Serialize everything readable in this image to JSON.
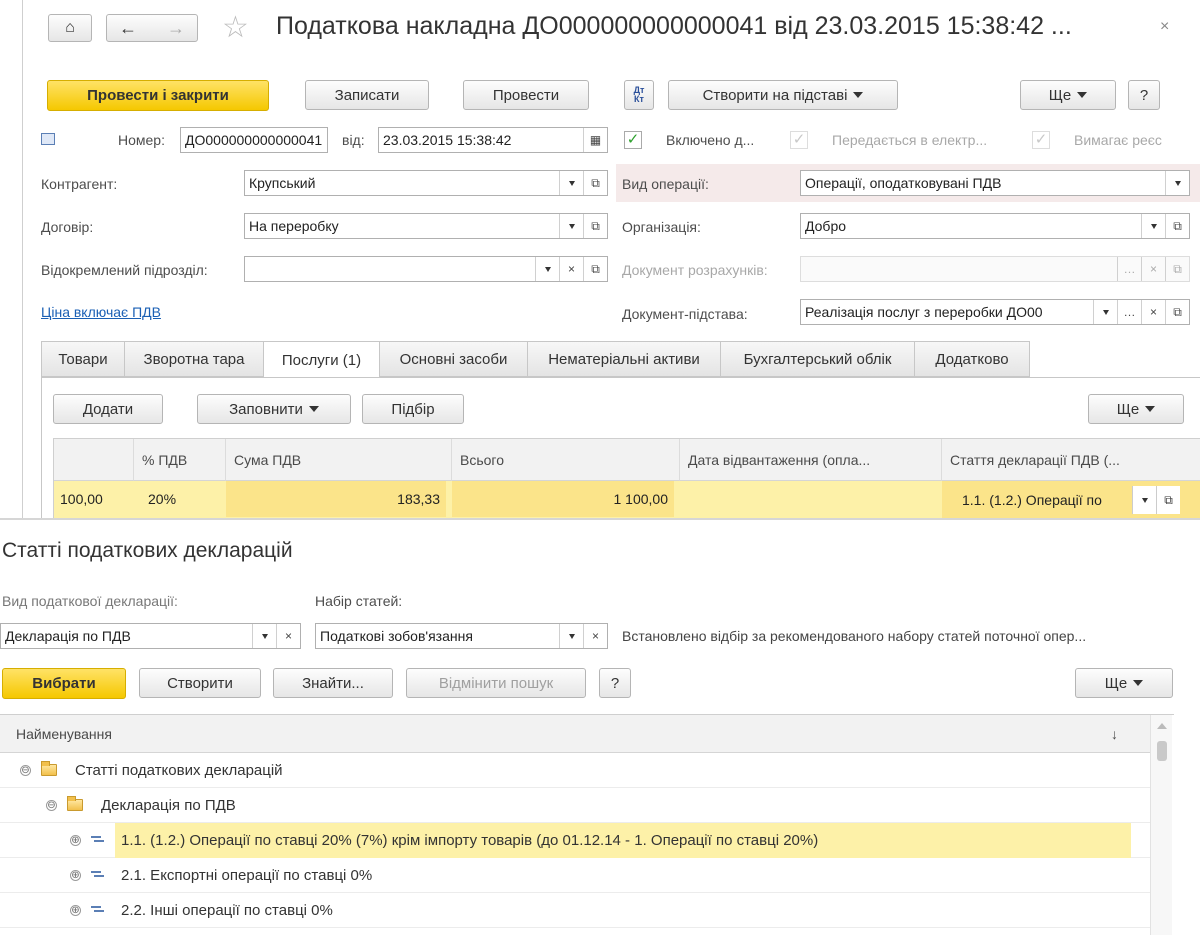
{
  "doc": {
    "title": "Податкова накладна ДО000000000000041 від 23.03.2015 15:38:42 ...",
    "toolbar": {
      "post_close": "Провести і закрити",
      "save": "Записати",
      "post": "Провести",
      "dtkt": "Дт Кт",
      "create_basis": "Створити на підставі",
      "more": "Ще",
      "help": "?"
    },
    "number_label": "Номер:",
    "number_value": "ДО000000000000041",
    "date_label": "від:",
    "date_value": "23.03.2015 15:38:42",
    "check1": "Включено д...",
    "check2": "Передається в електр...",
    "check3": "Вимагає реєс",
    "counterparty_label": "Контрагент:",
    "counterparty_value": "Крупський",
    "contract_label": "Договір:",
    "contract_value": "На переробку",
    "subdivision_label": "Відокремлений підрозділ:",
    "subdivision_value": "",
    "vat_link": "Ціна включає ПДВ",
    "op_type_label": "Вид операції:",
    "op_type_value": "Операції, оподатковувані ПДВ",
    "org_label": "Організація:",
    "org_value": "Добро",
    "settle_doc_label": "Документ розрахунків:",
    "settle_doc_value": "",
    "basis_doc_label": "Документ-підстава:",
    "basis_doc_value": "Реалізація послуг з переробки ДО00",
    "tabs": [
      "Товари",
      "Зворотна тара",
      "Послуги (1)",
      "Основні засоби",
      "Нематеріальні активи",
      "Бухгалтерський облік",
      "Додатково"
    ],
    "grid_toolbar": {
      "add": "Додати",
      "fill": "Заповнити",
      "pick": "Підбір",
      "more": "Ще"
    },
    "grid_headers": [
      "% ПДВ",
      "Сума ПДВ",
      "Всього",
      "Дата відвантаження (опла...",
      "Стаття декларації ПДВ (..."
    ],
    "grid_row": {
      "qty": "100,00",
      "vat_rate": "20%",
      "vat_sum": "183,33",
      "total": "1 100,00",
      "ship_date": "",
      "decl_item": "1.1. (1.2.) Операції по"
    }
  },
  "picker": {
    "title": "Статті податкових декларацій",
    "decl_type_label": "Вид податкової декларації:",
    "decl_type_value": "Декларація по ПДВ",
    "set_label": "Набір статей:",
    "set_value": "Податкові зобов'язання",
    "filter_note": "Встановлено відбір за рекомендованого набору статей поточної опер...",
    "toolbar": {
      "select": "Вибрати",
      "create": "Створити",
      "find": "Знайти...",
      "cancel_search": "Відмінити пошук",
      "help": "?",
      "more": "Ще"
    },
    "column": "Найменування",
    "sort_arrow": "↓",
    "tree": [
      {
        "label": "Статті податкових декларацій",
        "level": 0,
        "kind": "folder",
        "toggle": "⊖"
      },
      {
        "label": "Декларація по ПДВ",
        "level": 1,
        "kind": "folder",
        "toggle": "⊖"
      },
      {
        "label": "1.1. (1.2.) Операції по ставці 20% (7%) крім імпорту товарів (до 01.12.14 - 1. Операції по ставці 20%)",
        "level": 2,
        "kind": "item",
        "toggle": "⊕",
        "selected": true
      },
      {
        "label": "2.1. Експортні операції по ставці 0%",
        "level": 2,
        "kind": "item",
        "toggle": "⊕"
      },
      {
        "label": "2.2. Інші операції по ставці 0%",
        "level": 2,
        "kind": "item",
        "toggle": "⊕"
      }
    ]
  },
  "colors": {
    "accent_yellow": "#f5c800",
    "row_highlight": "#fdf1a8",
    "link": "#1a5fb4"
  }
}
